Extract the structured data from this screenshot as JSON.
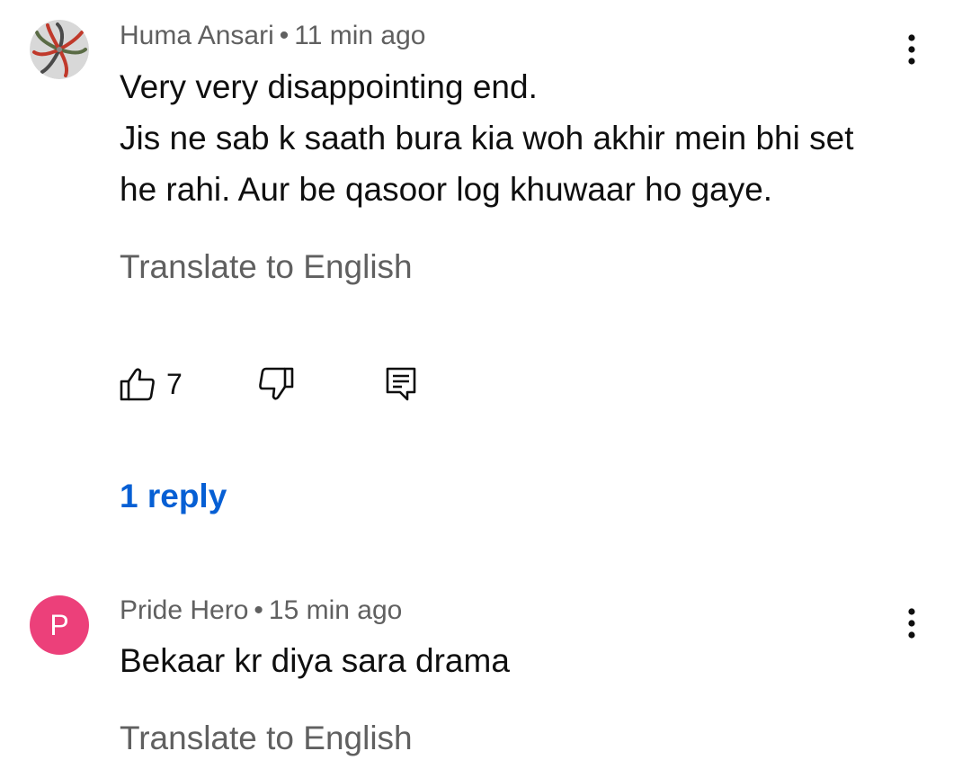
{
  "comments": [
    {
      "author": "Huma Ansari",
      "separator": "•",
      "time": "11 min ago",
      "text_lines": [
        "Very very disappointing end.",
        "Jis ne sab k saath bura kia woh akhir mein bhi set",
        "he rahi. Aur be qasoor log khuwaar ho gaye."
      ],
      "translate_label": "Translate to English",
      "like_count": "7",
      "replies_label": "1 reply",
      "avatar_icon": "pinwheel-avatar-icon"
    },
    {
      "author": "Pride Hero",
      "separator": "•",
      "time": "15 min ago",
      "avatar_letter": "P",
      "avatar_color": "#ec407a",
      "text_lines": [
        "Bekaar kr diya sara drama"
      ],
      "translate_label": "Translate to English"
    }
  ],
  "colors": {
    "link": "#065fd4",
    "secondary_text": "#606060",
    "primary_text": "#0f0f0f"
  },
  "icons": {
    "like": "thumbs-up-icon",
    "dislike": "thumbs-down-icon",
    "reply": "comment-reply-icon",
    "more": "more-vert-icon"
  }
}
